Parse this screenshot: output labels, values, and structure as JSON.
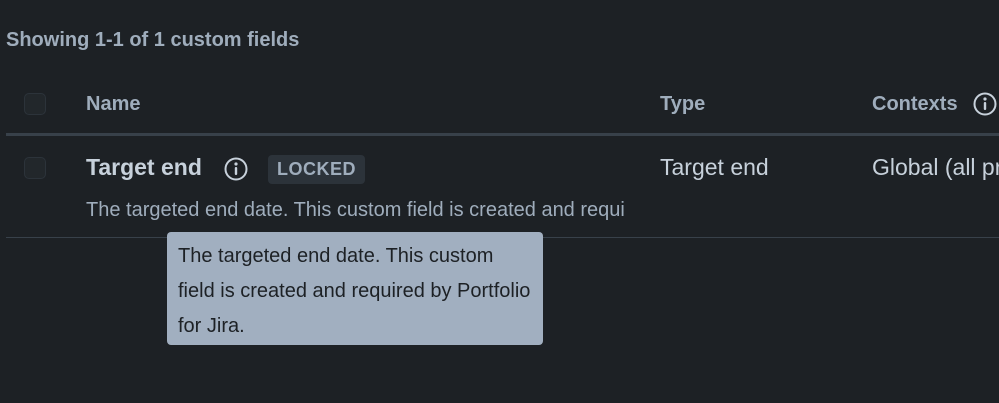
{
  "summary": {
    "text": "Showing 1-1 of 1 custom fields"
  },
  "table": {
    "headers": {
      "name": "Name",
      "type": "Type",
      "contexts": "Contexts"
    },
    "rows": [
      {
        "name": "Target end",
        "badge": "LOCKED",
        "description": "The targeted end date. This custom field is created and required by Portfolio for Jira.",
        "type": "Target end",
        "contexts": "Global (all projects)"
      }
    ]
  },
  "tooltip": {
    "text": "The targeted end date. This custom field is created and required by Portfolio for Jira."
  },
  "icons": {
    "info": "info-icon",
    "checkbox": "checkbox-icon"
  },
  "colors": {
    "background": "#1d2125",
    "muted_text": "#9fadbc",
    "primary_text": "#c7d1db",
    "tooltip_bg": "#a1afc0",
    "divider": "#38414a"
  }
}
